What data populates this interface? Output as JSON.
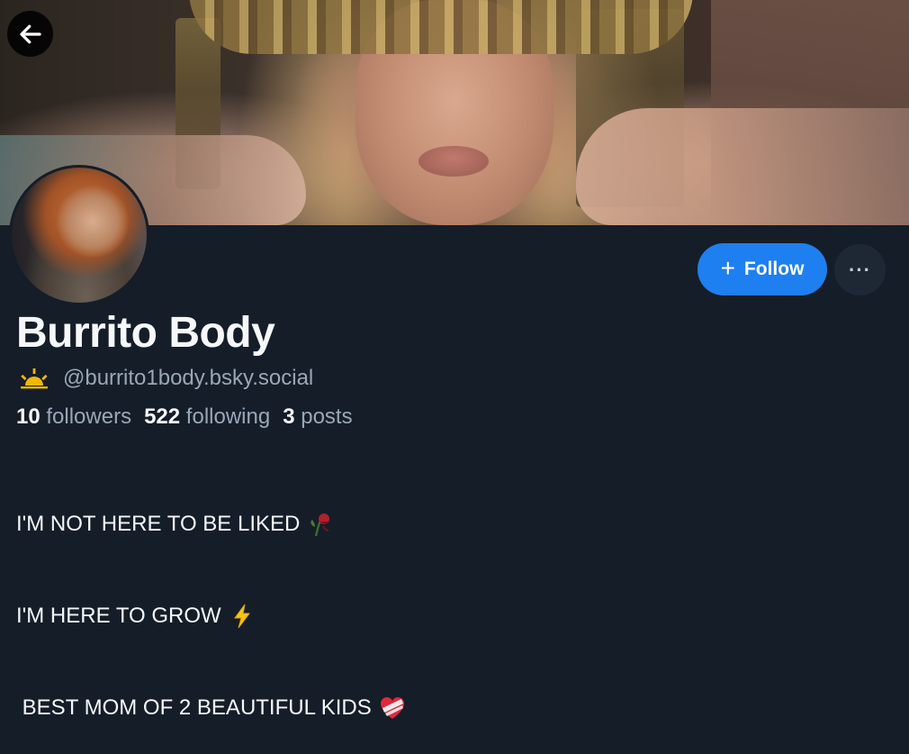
{
  "profile": {
    "display_name": "Burrito Body",
    "handle": "@burrito1body.bsky.social",
    "followers_count": "10",
    "followers_label": "followers",
    "following_count": "522",
    "following_label": "following",
    "posts_count": "3",
    "posts_label": "posts",
    "bio_lines": [
      "I'M NOT HERE TO BE LIKED",
      "I'M HERE TO GROW",
      " BEST MOM OF 2 BEAUTIFUL KIDS"
    ],
    "bio_emojis": [
      "wilted-rose-icon",
      "lightning-icon",
      "heart-bandaged-icon"
    ]
  },
  "actions": {
    "follow_label": "Follow",
    "more_label": "···"
  },
  "icons": {
    "back": "arrow-left-icon",
    "handle_badge": "sunrise-icon"
  },
  "colors": {
    "background": "#151d28",
    "accent": "#1e7ff0",
    "muted_text": "#9aa7b5",
    "badge_yellow": "#f2b705"
  }
}
